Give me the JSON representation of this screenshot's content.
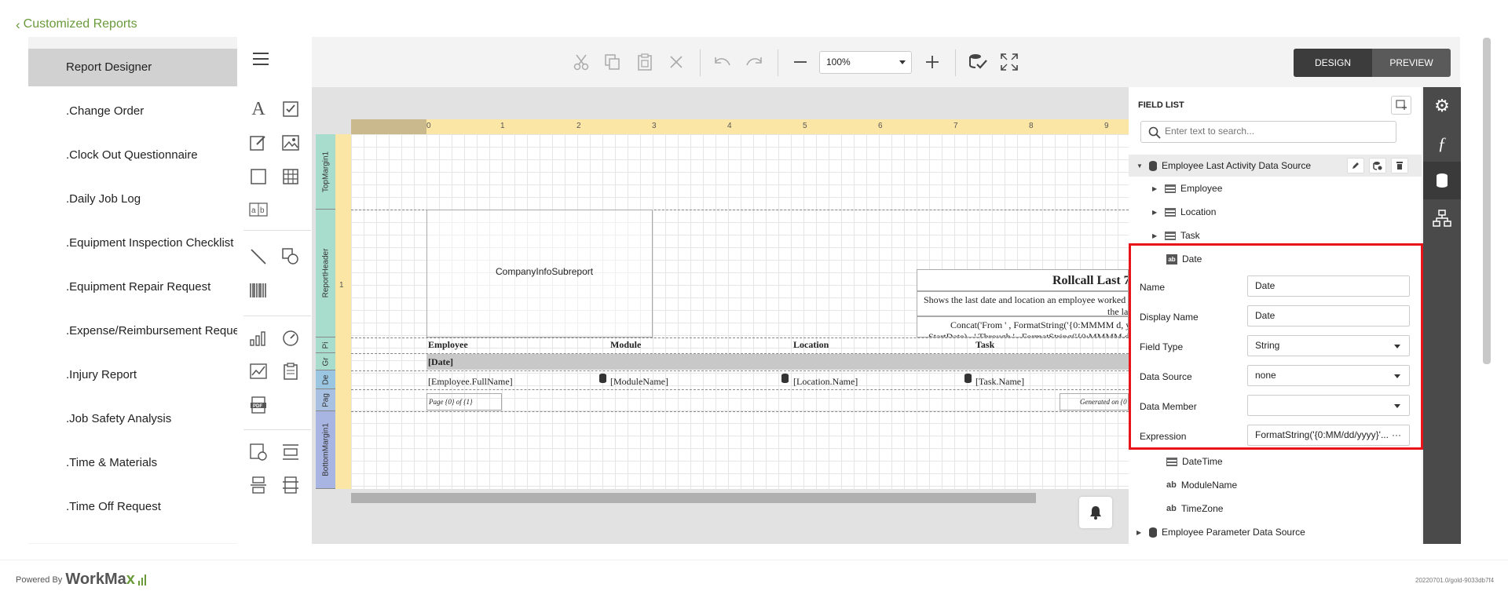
{
  "back_link": "Customized Reports",
  "sidebar": {
    "items": [
      {
        "label": "Report Designer",
        "selected": true
      },
      {
        "label": ".Change Order"
      },
      {
        "label": ".Clock Out Questionnaire"
      },
      {
        "label": ".Daily Job Log"
      },
      {
        "label": ".Equipment Inspection Checklist"
      },
      {
        "label": ".Equipment Repair Request"
      },
      {
        "label": ".Expense/Reimbursement Request"
      },
      {
        "label": ".Injury Report"
      },
      {
        "label": ".Job Safety Analysis"
      },
      {
        "label": ".Time & Materials"
      },
      {
        "label": ".Time Off Request"
      }
    ]
  },
  "toolbar": {
    "zoom": "100%",
    "mode_design": "DESIGN",
    "mode_preview": "PREVIEW"
  },
  "ruler": {
    "labels": [
      "0",
      "1",
      "2",
      "3",
      "4",
      "5",
      "6",
      "7",
      "8",
      "9"
    ],
    "vlabel": "1"
  },
  "bands": [
    "TopMargin1",
    "ReportHeader",
    "Pi",
    "Gr",
    "De",
    "Pag",
    "BottomMargin1"
  ],
  "report": {
    "subreport": "CompanyInfoSubreport",
    "title": "Rollcall Last 7",
    "subtitle_1": "Shows the last date and location an employee worked",
    "subtitle_2": "the last",
    "concat_1": "Concat('From ' , FormatString('{0:MMMM d, y",
    "concat_2": "StartDate) , ' Through ' , FormatString('{0:MMMM d, y",
    "col_employee": "Employee",
    "col_module": "Module",
    "col_location": "Location",
    "col_task": "Task",
    "group_date": "[Date]",
    "detail_employee": "[Employee.FullName]",
    "detail_module": "[ModuleName]",
    "detail_location": "[Location.Name]",
    "detail_task": "[Task.Name]",
    "page_info": "Page {0} of {1}",
    "generated": "Generated on {0"
  },
  "field_list": {
    "title": "FIELD LIST",
    "search_placeholder": "Enter text to search...",
    "datasource": "Employee Last Activity Data Source",
    "children": [
      "Employee",
      "Location",
      "Task"
    ],
    "selected": "Date",
    "props": [
      {
        "label": "Name",
        "value": "Date",
        "dropdown": false
      },
      {
        "label": "Display Name",
        "value": "Date",
        "dropdown": false
      },
      {
        "label": "Field Type",
        "value": "String",
        "dropdown": true
      },
      {
        "label": "Data Source",
        "value": "none",
        "dropdown": true
      },
      {
        "label": "Data Member",
        "value": "",
        "dropdown": true
      },
      {
        "label": "Expression",
        "value": "FormatString('{0:MM/dd/yyyy}'...",
        "dropdown": false
      }
    ],
    "after": [
      {
        "label": "DateTime",
        "icon": "table"
      },
      {
        "label": "ModuleName",
        "icon": "ab"
      },
      {
        "label": "TimeZone",
        "icon": "ab"
      }
    ],
    "datasource2": "Employee Parameter Data Source"
  },
  "footer": {
    "powered": "Powered By",
    "brand_a": "WorkMa",
    "brand_b": "x",
    "version": "20220701.0/gold-9033db7f4"
  },
  "colors": {
    "accent_green": "#6a9a3a",
    "highlight_red": "#e8141a"
  }
}
